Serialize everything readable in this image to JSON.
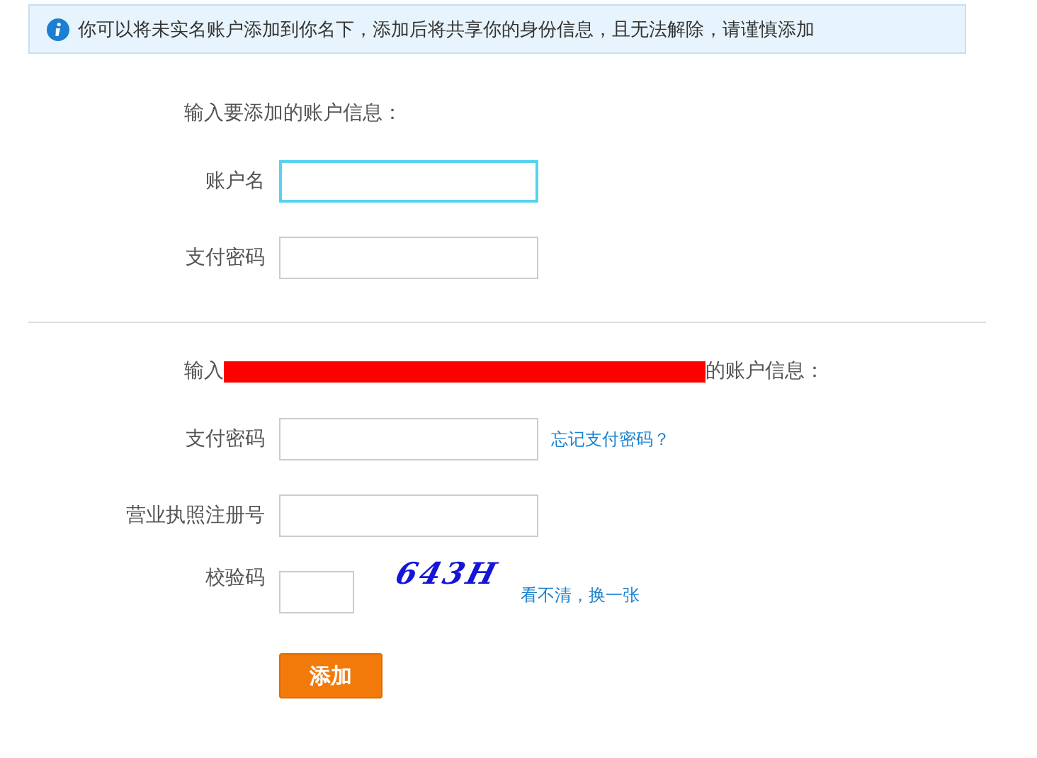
{
  "notice": {
    "text": "你可以将未实名账户添加到你名下，添加后将共享你的身份信息，且无法解除，请谨慎添加"
  },
  "sections": [
    {
      "heading_before": "输入要添加的账户信息：",
      "redacted": false,
      "rows": [
        {
          "kind": "field",
          "label": "账户名",
          "focused": true
        },
        {
          "kind": "field",
          "label": "支付密码",
          "focused": false
        }
      ]
    },
    {
      "heading_before": "输入",
      "redacted": true,
      "heading_after": "的账户信息：",
      "rows": [
        {
          "kind": "field",
          "label": "支付密码",
          "focused": false,
          "link": "忘记支付密码？"
        },
        {
          "kind": "field",
          "label": "营业执照注册号",
          "focused": false
        },
        {
          "kind": "captcha",
          "label": "校验码",
          "focused": false,
          "captcha": "643H",
          "link": "看不清，换一张"
        }
      ]
    }
  ],
  "button": "添加"
}
